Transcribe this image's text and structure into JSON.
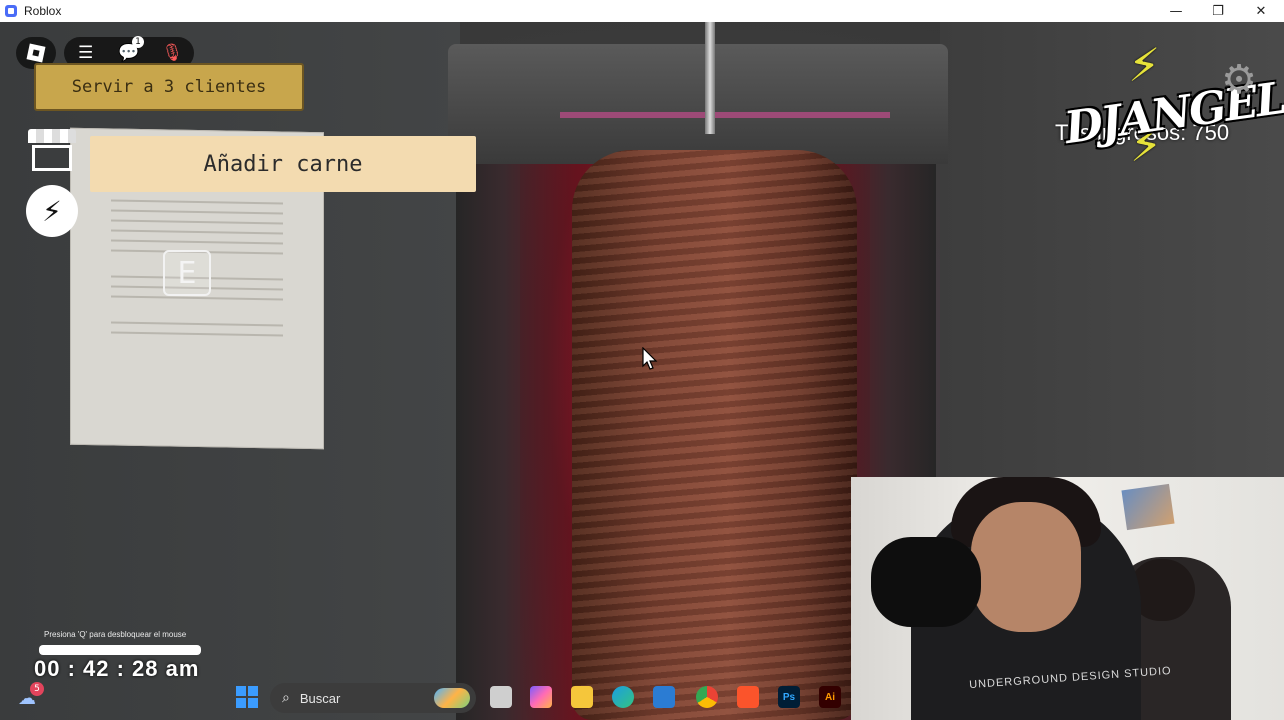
{
  "window": {
    "title": "Roblox",
    "minimize_glyph": "—",
    "maximize_glyph": "❐",
    "close_glyph": "✕"
  },
  "hud": {
    "objective": "Servir a 3 clientes",
    "action_prompt": "Añadir carne",
    "interact_key": "E",
    "chat_badge": "1",
    "score_text": "Tus ingresos: 750",
    "logo_text": "DJANGEL",
    "unlock_hint": "Presiona 'Q' para desbloquear el mouse",
    "clock": "00 : 42 : 28 am"
  },
  "webcam": {
    "shirt_text": "UNDERGROUND DESIGN STUDIO"
  },
  "taskbar": {
    "search_placeholder": "Buscar",
    "weather_badge": "5",
    "apps": [
      {
        "name": "task-view",
        "label": ""
      },
      {
        "name": "copilot",
        "label": ""
      },
      {
        "name": "file-explorer",
        "label": ""
      },
      {
        "name": "edge",
        "label": ""
      },
      {
        "name": "microsoft-store",
        "label": ""
      },
      {
        "name": "chrome",
        "label": ""
      },
      {
        "name": "brave",
        "label": ""
      },
      {
        "name": "photoshop",
        "label": "Ps"
      },
      {
        "name": "illustrator",
        "label": "Ai"
      }
    ]
  },
  "colors": {
    "objective_bg": "#c8a64c",
    "action_bg": "#f3dbb0",
    "start_blue": "#3b9cff"
  }
}
